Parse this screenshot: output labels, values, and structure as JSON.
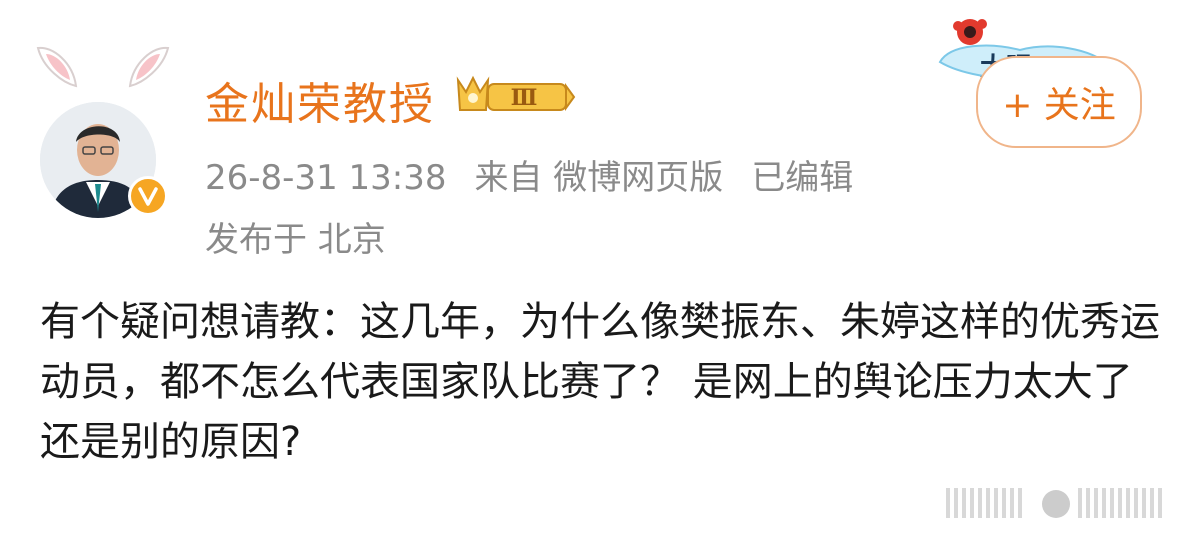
{
  "author": {
    "name": "金灿荣教授",
    "rank_badge": "Ⅲ",
    "verified_icon": "verified-v-icon"
  },
  "meta": {
    "time": "26-8-31 13:38",
    "source": "来自 微博网页版",
    "edited": "已编辑",
    "location": "发布于 北京"
  },
  "follow": {
    "label": "+ 关注",
    "decoration": "大眼"
  },
  "content": {
    "text": "有个疑问想请教：这几年，为什么像樊振东、朱婷这样的优秀运动员，都不怎么代表国家队比赛了？ 是网上的舆论压力太大了还是别的原因?"
  },
  "colors": {
    "accent": "#e8741c",
    "meta": "#8a8a8a",
    "text": "#1a1a1a"
  }
}
